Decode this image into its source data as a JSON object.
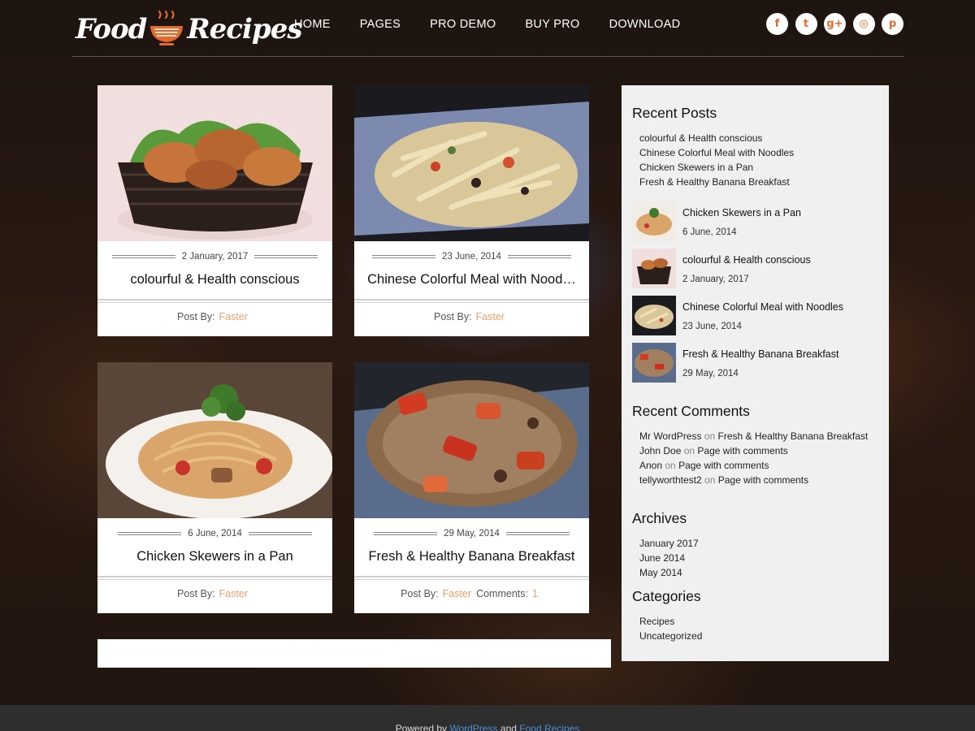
{
  "header": {
    "logo_word1": "Food",
    "logo_word2": "Recipes",
    "nav": [
      "HOME",
      "PAGES",
      "PRO DEMO",
      "BUY PRO",
      "DOWNLOAD"
    ],
    "social": [
      {
        "icon": "facebook-icon",
        "glyph": "f"
      },
      {
        "icon": "twitter-icon",
        "glyph": "t"
      },
      {
        "icon": "google-plus-icon",
        "glyph": "g+"
      },
      {
        "icon": "dribbble-icon",
        "glyph": "◎"
      },
      {
        "icon": "pinterest-icon",
        "glyph": "p"
      }
    ]
  },
  "posts": [
    {
      "date": "2 January, 2017",
      "title": "colourful & Health conscious",
      "post_by_label": "Post By:",
      "author": "Faster",
      "image": "fried-chicken-basket"
    },
    {
      "date": "23 June, 2014",
      "title": "Chinese Colorful Meal with Nood…",
      "post_by_label": "Post By:",
      "author": "Faster",
      "image": "pasta-plate"
    },
    {
      "date": "6 June, 2014",
      "title": "Chicken Skewers in a Pan",
      "post_by_label": "Post By:",
      "author": "Faster",
      "image": "spaghetti-plate"
    },
    {
      "date": "29 May, 2014",
      "title": "Fresh & Healthy Banana Breakfast",
      "post_by_label": "Post By:",
      "author": "Faster",
      "comments_label": "Comments:",
      "comments_count": "1",
      "image": "fried-rice-plate"
    }
  ],
  "sidebar": {
    "recent_posts_title": "Recent Posts",
    "recent_posts": [
      "colourful & Health conscious",
      "Chinese Colorful Meal with Noodles",
      "Chicken Skewers in a Pan",
      "Fresh & Healthy Banana Breakfast"
    ],
    "thumb_posts": [
      {
        "title": "Chicken Skewers in a Pan",
        "date": "6 June, 2014"
      },
      {
        "title": "colourful & Health conscious",
        "date": "2 January, 2017"
      },
      {
        "title": "Chinese Colorful Meal with Noodles",
        "date": "23 June, 2014"
      },
      {
        "title": "Fresh & Healthy Banana Breakfast",
        "date": "29 May, 2014"
      }
    ],
    "recent_comments_title": "Recent Comments",
    "comments": [
      {
        "author": "Mr WordPress",
        "on": "on",
        "post": "Fresh & Healthy Banana Breakfast"
      },
      {
        "author": "John Doe",
        "on": "on",
        "post": "Page with comments"
      },
      {
        "author": "Anon",
        "on": "on",
        "post": "Page with comments"
      },
      {
        "author": "tellyworthtest2",
        "on": "on",
        "post": "Page with comments"
      }
    ],
    "archives_title": "Archives",
    "archives": [
      "January 2017",
      "June 2014",
      "May 2014"
    ],
    "categories_title": "Categories",
    "categories": [
      "Recipes",
      "Uncategorized"
    ]
  },
  "footer": {
    "powered_by": "Powered by",
    "wordpress": "WordPress",
    "and": "and",
    "theme": "Food Recipes"
  },
  "colors": {
    "accent": "#e9a06a",
    "social_icon": "#e26a2c",
    "footer_link": "#4a8fd6"
  }
}
